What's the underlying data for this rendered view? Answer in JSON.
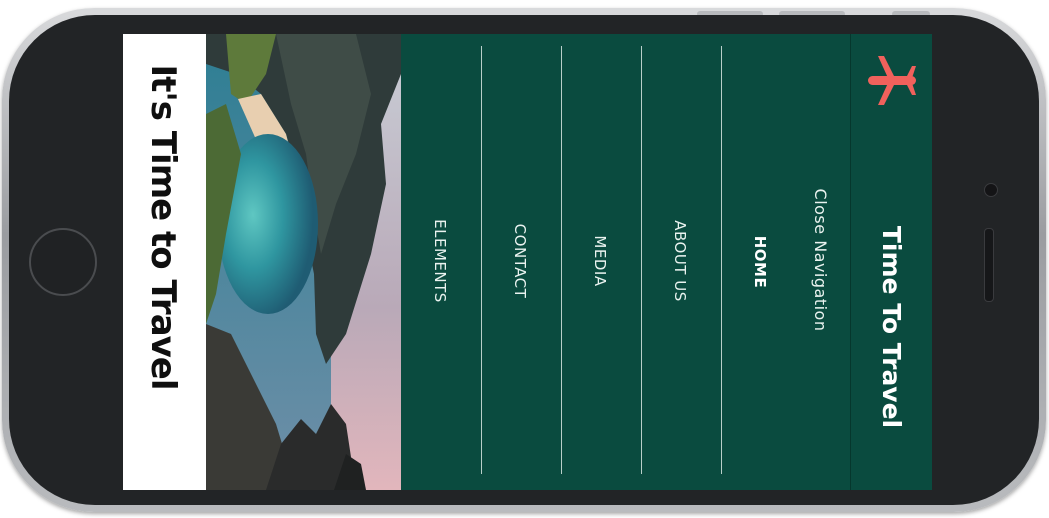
{
  "app": {
    "brand_title": "Time To Travel",
    "hero_title": "It's Time to Travel",
    "logo_icon": "airplane-icon",
    "colors": {
      "nav_background": "#0a4b3f",
      "logo_accent": "#f0615c",
      "hero_background": "#ffffff"
    }
  },
  "nav": {
    "close_label": "Close Navigation",
    "items": [
      {
        "label": "HOME",
        "active": true
      },
      {
        "label": "ABOUT US",
        "active": false
      },
      {
        "label": "MEDIA",
        "active": false
      },
      {
        "label": "CONTACT",
        "active": false
      },
      {
        "label": "ELEMENTS",
        "active": false
      }
    ]
  }
}
